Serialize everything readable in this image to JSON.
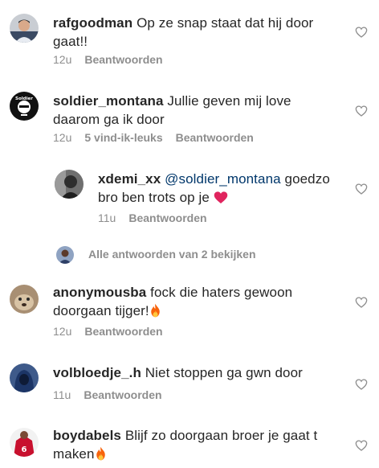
{
  "comments": [
    {
      "username": "rafgoodman",
      "text": "Op ze snap staat dat hij door gaat!!",
      "time": "12u",
      "reply": "Beantwoorden",
      "avatar": "person-avatar"
    },
    {
      "username": "soldier_montana",
      "text": "Jullie geven mij love daarom ga ik door",
      "time": "12u",
      "likes": "5 vind-ik-leuks",
      "reply": "Beantwoorden",
      "avatar": "soldier-logo-avatar",
      "avatar_text": "Soldier"
    },
    {
      "username": "xdemi_xx",
      "mention": "@soldier_montana",
      "text": "goedzo bro ben trots op je",
      "time": "11u",
      "reply": "Beantwoorden",
      "avatar": "person-avatar",
      "emoji": "red-heart"
    },
    {
      "username": "anonymousba",
      "text": "fock die haters gewoon doorgaan tijger!",
      "time": "12u",
      "reply": "Beantwoorden",
      "avatar": "dog-avatar",
      "emoji": "fire"
    },
    {
      "username": "volbloedje_.h",
      "text": "Niet stoppen ga gwn door",
      "time": "11u",
      "reply": "Beantwoorden",
      "avatar": "hoodie-avatar"
    },
    {
      "username": "boydabels",
      "text": "Blijf zo doorgaan broer je gaat t maken",
      "avatar": "football-jersey-avatar",
      "emoji": "fire"
    }
  ],
  "view_replies": {
    "label": "Alle antwoorden van 2 bekijken"
  },
  "colors": {
    "text": "#262626",
    "secondary": "#8e8e8e",
    "mention": "#00376b",
    "heart_outline": "#8e8e8e",
    "emoji_heart": "#e0245e"
  }
}
